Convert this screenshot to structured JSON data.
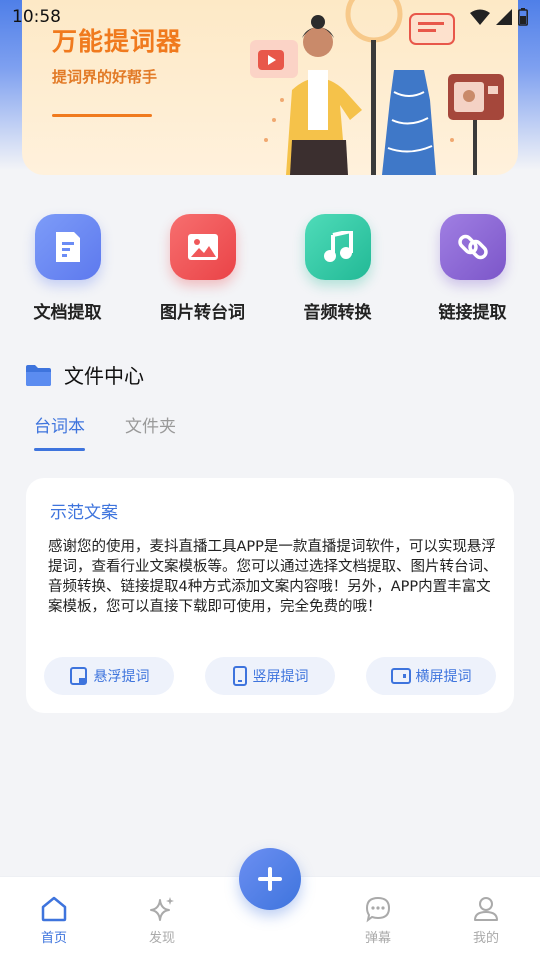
{
  "status_bar": {
    "time": "10:58"
  },
  "banner": {
    "title": "万能提词器",
    "subtitle": "提词界的好帮手"
  },
  "functions": [
    {
      "label": "文档提取",
      "icon": "document-icon",
      "color": "#6b8cf5"
    },
    {
      "label": "图片转台词",
      "icon": "image-icon",
      "color": "#f0585a"
    },
    {
      "label": "音频转换",
      "icon": "music-icon",
      "color": "#35c9a7"
    },
    {
      "label": "链接提取",
      "icon": "link-icon",
      "color": "#8e6bd6"
    }
  ],
  "file_center": {
    "title": "文件中心",
    "tabs": [
      {
        "label": "台词本",
        "active": true
      },
      {
        "label": "文件夹",
        "active": false
      }
    ]
  },
  "card": {
    "title": "示范文案",
    "body": "感谢您的使用，麦抖直播工具APP是一款直播提词软件，可以实现悬浮提词，查看行业文案模板等。您可以通过选择文档提取、图片转台词、音频转换、链接提取4种方式添加文案内容哦！另外，APP内置丰富文案模板，您可以直接下载即可使用，完全免费的哦！",
    "actions": [
      "悬浮提词",
      "竖屏提词",
      "横屏提词"
    ]
  },
  "bottom_nav": [
    {
      "label": "首页",
      "icon": "home-icon",
      "active": true
    },
    {
      "label": "发现",
      "icon": "sparkle-icon",
      "active": false
    },
    {
      "label": "弹幕",
      "icon": "chat-icon",
      "active": false
    },
    {
      "label": "我的",
      "icon": "user-icon",
      "active": false
    }
  ],
  "colors": {
    "accent": "#3e74dd",
    "banner_orange": "#f07a1e"
  }
}
